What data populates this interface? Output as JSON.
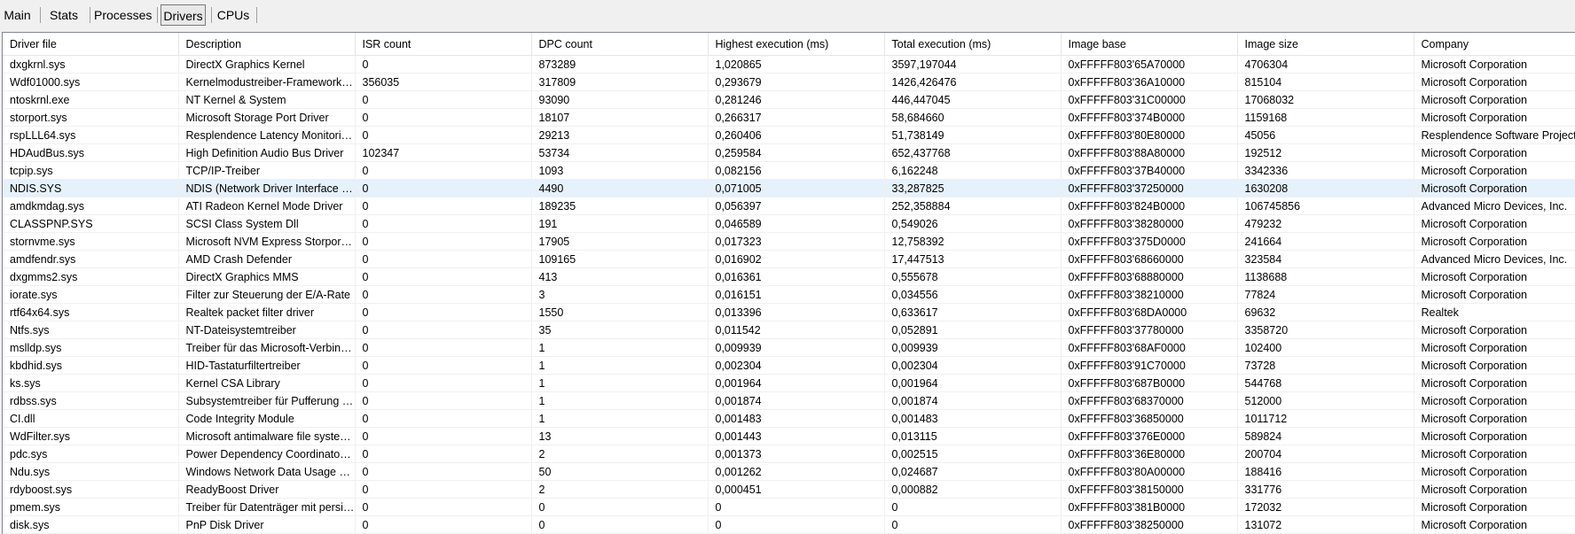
{
  "tabs": [
    {
      "label": "Main",
      "active": false
    },
    {
      "label": "Stats",
      "active": false
    },
    {
      "label": "Processes",
      "active": false
    },
    {
      "label": "Drivers",
      "active": true
    },
    {
      "label": "CPUs",
      "active": false
    }
  ],
  "table": {
    "columns": [
      "Driver file",
      "Description",
      "ISR count",
      "DPC count",
      "Highest execution (ms)",
      "Total execution (ms)",
      "Image base",
      "Image size",
      "Company"
    ],
    "selected_row": 7,
    "rows": [
      [
        "dxgkrnl.sys",
        "DirectX Graphics Kernel",
        "0",
        "873289",
        "1,020865",
        "3597,197044",
        "0xFFFFF803'65A70000",
        "4706304",
        "Microsoft Corporation"
      ],
      [
        "Wdf01000.sys",
        "Kernelmodustreiber-Frameworks-Laufzeit",
        "356035",
        "317809",
        "0,293679",
        "1426,426476",
        "0xFFFFF803'36A10000",
        "815104",
        "Microsoft Corporation"
      ],
      [
        "ntoskrnl.exe",
        "NT Kernel & System",
        "0",
        "93090",
        "0,281246",
        "446,447045",
        "0xFFFFF803'31C00000",
        "17068032",
        "Microsoft Corporation"
      ],
      [
        "storport.sys",
        "Microsoft Storage Port Driver",
        "0",
        "18107",
        "0,266317",
        "58,684660",
        "0xFFFFF803'374B0000",
        "1159168",
        "Microsoft Corporation"
      ],
      [
        "rspLLL64.sys",
        "Resplendence Latency Monitoring Driver",
        "0",
        "29213",
        "0,260406",
        "51,738149",
        "0xFFFFF803'80E80000",
        "45056",
        "Resplendence Software Projects"
      ],
      [
        "HDAudBus.sys",
        "High Definition Audio Bus Driver",
        "102347",
        "53734",
        "0,259584",
        "652,437768",
        "0xFFFFF803'88A80000",
        "192512",
        "Microsoft Corporation"
      ],
      [
        "tcpip.sys",
        "TCP/IP-Treiber",
        "0",
        "1093",
        "0,082156",
        "6,162248",
        "0xFFFFF803'37B40000",
        "3342336",
        "Microsoft Corporation"
      ],
      [
        "NDIS.SYS",
        "NDIS (Network Driver Interface Specification)",
        "0",
        "4490",
        "0,071005",
        "33,287825",
        "0xFFFFF803'37250000",
        "1630208",
        "Microsoft Corporation"
      ],
      [
        "amdkmdag.sys",
        "ATI Radeon Kernel Mode Driver",
        "0",
        "189235",
        "0,056397",
        "252,358884",
        "0xFFFFF803'824B0000",
        "106745856",
        "Advanced Micro Devices, Inc."
      ],
      [
        "CLASSPNP.SYS",
        "SCSI Class System Dll",
        "0",
        "191",
        "0,046589",
        "0,549026",
        "0xFFFFF803'38280000",
        "479232",
        "Microsoft Corporation"
      ],
      [
        "stornvme.sys",
        "Microsoft NVM Express Storport Miniport Driver",
        "0",
        "17905",
        "0,017323",
        "12,758392",
        "0xFFFFF803'375D0000",
        "241664",
        "Microsoft Corporation"
      ],
      [
        "amdfendr.sys",
        "AMD Crash Defender",
        "0",
        "109165",
        "0,016902",
        "17,447513",
        "0xFFFFF803'68660000",
        "323584",
        "Advanced Micro Devices, Inc."
      ],
      [
        "dxgmms2.sys",
        "DirectX Graphics MMS",
        "0",
        "413",
        "0,016361",
        "0,555678",
        "0xFFFFF803'68880000",
        "1138688",
        "Microsoft Corporation"
      ],
      [
        "iorate.sys",
        "Filter zur Steuerung der E/A-Rate",
        "0",
        "3",
        "0,016151",
        "0,034556",
        "0xFFFFF803'38210000",
        "77824",
        "Microsoft Corporation"
      ],
      [
        "rtf64x64.sys",
        "Realtek packet filter driver",
        "0",
        "1550",
        "0,013396",
        "0,633617",
        "0xFFFFF803'68DA0000",
        "69632",
        "Realtek"
      ],
      [
        "Ntfs.sys",
        "NT-Dateisystemtreiber",
        "0",
        "35",
        "0,011542",
        "0,052891",
        "0xFFFFF803'37780000",
        "3358720",
        "Microsoft Corporation"
      ],
      [
        "mslldp.sys",
        "Treiber für das Microsoft-Verbindungsschicht-Ermittlungsprotokoll",
        "0",
        "1",
        "0,009939",
        "0,009939",
        "0xFFFFF803'68AF0000",
        "102400",
        "Microsoft Corporation"
      ],
      [
        "kbdhid.sys",
        "HID-Tastaturfiltertreiber",
        "0",
        "1",
        "0,002304",
        "0,002304",
        "0xFFFFF803'91C70000",
        "73728",
        "Microsoft Corporation"
      ],
      [
        "ks.sys",
        "Kernel CSA Library",
        "0",
        "1",
        "0,001964",
        "0,001964",
        "0xFFFFF803'687B0000",
        "544768",
        "Microsoft Corporation"
      ],
      [
        "rdbss.sys",
        "Subsystemtreiber für Pufferung umgeleiteter Laufwerke",
        "0",
        "1",
        "0,001874",
        "0,001874",
        "0xFFFFF803'68370000",
        "512000",
        "Microsoft Corporation"
      ],
      [
        "CI.dll",
        "Code Integrity Module",
        "0",
        "1",
        "0,001483",
        "0,001483",
        "0xFFFFF803'36850000",
        "1011712",
        "Microsoft Corporation"
      ],
      [
        "WdFilter.sys",
        "Microsoft antimalware file system filter driver",
        "0",
        "13",
        "0,001443",
        "0,013115",
        "0xFFFFF803'376E0000",
        "589824",
        "Microsoft Corporation"
      ],
      [
        "pdc.sys",
        "Power Dependency Coordinator Driver",
        "0",
        "2",
        "0,001373",
        "0,002515",
        "0xFFFFF803'36E80000",
        "200704",
        "Microsoft Corporation"
      ],
      [
        "Ndu.sys",
        "Windows Network Data Usage Monitoring Driver",
        "0",
        "50",
        "0,001262",
        "0,024687",
        "0xFFFFF803'80A00000",
        "188416",
        "Microsoft Corporation"
      ],
      [
        "rdyboost.sys",
        "ReadyBoost Driver",
        "0",
        "2",
        "0,000451",
        "0,000882",
        "0xFFFFF803'38150000",
        "331776",
        "Microsoft Corporation"
      ],
      [
        "pmem.sys",
        "Treiber für Datenträger mit persistentem Speicher",
        "0",
        "0",
        "0",
        "0",
        "0xFFFFF803'381B0000",
        "172032",
        "Microsoft Corporation"
      ],
      [
        "disk.sys",
        "PnP Disk Driver",
        "0",
        "0",
        "0",
        "0",
        "0xFFFFF803'38250000",
        "131072",
        "Microsoft Corporation"
      ]
    ]
  }
}
